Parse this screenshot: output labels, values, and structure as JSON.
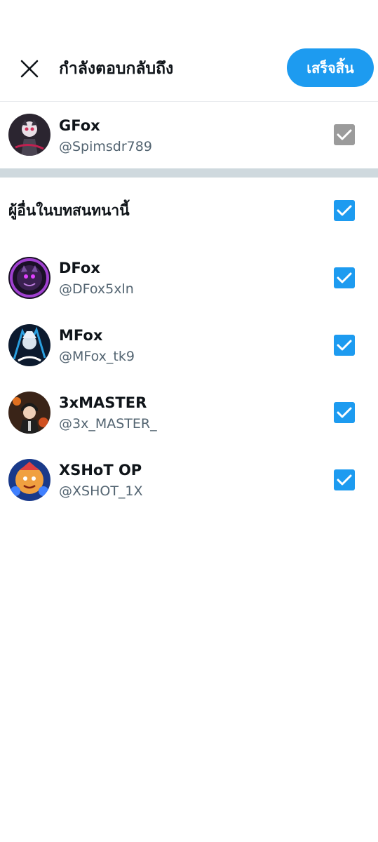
{
  "header": {
    "title": "กำลังตอบกลับถึง",
    "done_label": "เสร็จสิ้น"
  },
  "original_poster": {
    "name": "GFox",
    "handle": "@Spimsdr789",
    "checked": true,
    "disabled": true
  },
  "others_section": {
    "label": "ผู้อื่นในบทสนทนานี้",
    "checked": true
  },
  "others": [
    {
      "name": "DFox",
      "handle": "@DFox5xln",
      "checked": true
    },
    {
      "name": "MFox",
      "handle": "@MFox_tk9",
      "checked": true
    },
    {
      "name": "3xMASTER",
      "handle": "@3x_MASTER_",
      "checked": true
    },
    {
      "name": "XSHoT OP",
      "handle": "@XSHOT_1X",
      "checked": true
    }
  ],
  "colors": {
    "accent": "#1d9bf0",
    "disabled_check": "#9b9b9b",
    "secondary_text": "#536471",
    "divider": "#cfd9de"
  },
  "icons": {
    "close": "close-icon",
    "check": "checkmark-icon"
  }
}
